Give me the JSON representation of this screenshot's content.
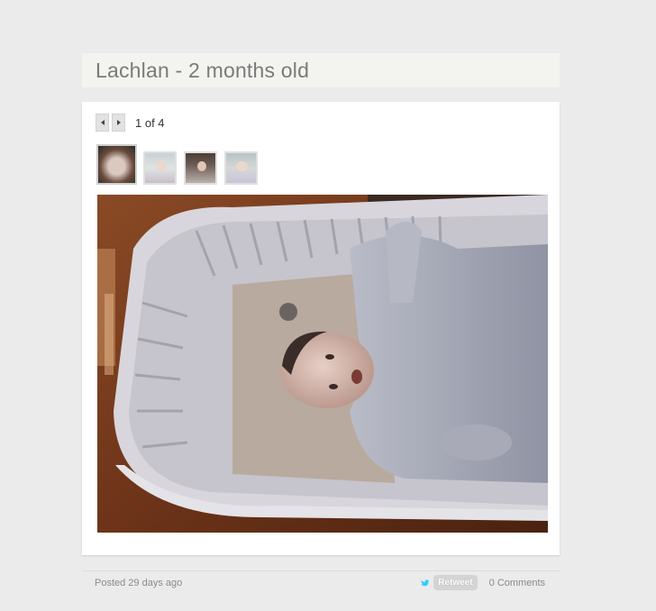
{
  "post": {
    "title": "Lachlan - 2 months old"
  },
  "gallery": {
    "counter": "1 of 4",
    "prev_icon": "arrow-left-icon",
    "next_icon": "arrow-right-icon",
    "thumbnails": [
      {
        "name": "thumbnail-1",
        "active": true
      },
      {
        "name": "thumbnail-2",
        "active": false
      },
      {
        "name": "thumbnail-3",
        "active": false
      },
      {
        "name": "thumbnail-4",
        "active": false
      }
    ]
  },
  "footer": {
    "posted": "Posted 29 days ago",
    "retweet_label": "Retweet",
    "comments": "0 Comments",
    "twitter_icon": "twitter-bird-icon"
  },
  "colors": {
    "page_bg": "#ebebeb",
    "title_bg": "#f3f3ef",
    "title_text": "#7a7a7a",
    "twitter_blue": "#33ccff"
  }
}
